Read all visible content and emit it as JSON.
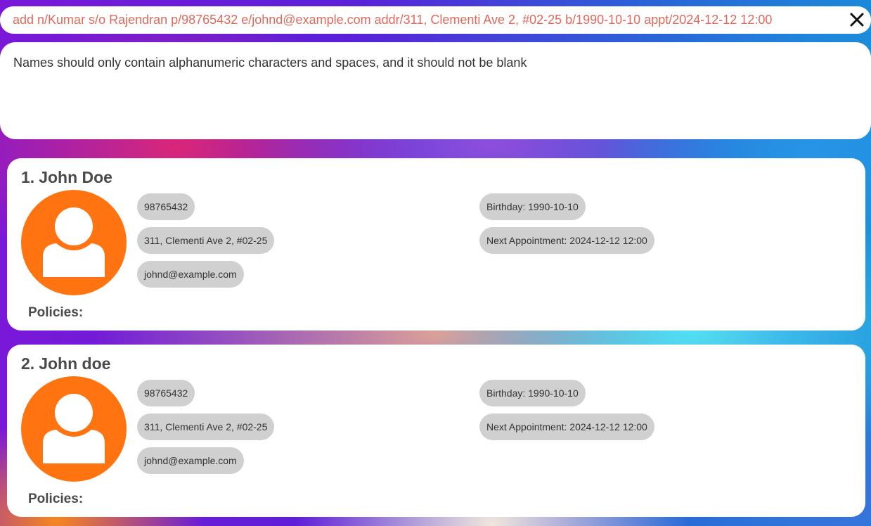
{
  "command_box": {
    "text": "add n/Kumar s/o Rajendran p/98765432 e/johnd@example.com addr/311, Clementi Ave 2, #02-25 b/1990-10-10 appt/2024-12-12 12:00",
    "close_icon": "close-icon"
  },
  "result_box": {
    "message": "Names should only contain alphanumeric characters and spaces, and it should not be blank"
  },
  "persons": [
    {
      "index": "1.",
      "name": "John Doe",
      "phone": "98765432",
      "address": "311, Clementi Ave 2, #02-25",
      "email": "johnd@example.com",
      "birthday": "Birthday: 1990-10-10",
      "appointment": "Next Appointment: 2024-12-12 12:00",
      "policies_label": "Policies:",
      "avatar_icon": "person-avatar-icon"
    },
    {
      "index": "2.",
      "name": "John doe",
      "phone": "98765432",
      "address": "311, Clementi Ave 2, #02-25",
      "email": "johnd@example.com",
      "birthday": "Birthday: 1990-10-10",
      "appointment": "Next Appointment: 2024-12-12 12:00",
      "policies_label": "Policies:",
      "avatar_icon": "person-avatar-icon"
    }
  ],
  "colors": {
    "command_text": "#e0695c",
    "avatar": "#ff7410",
    "chip_bg": "#d0d0d0",
    "card_bg": "#ffffff"
  }
}
